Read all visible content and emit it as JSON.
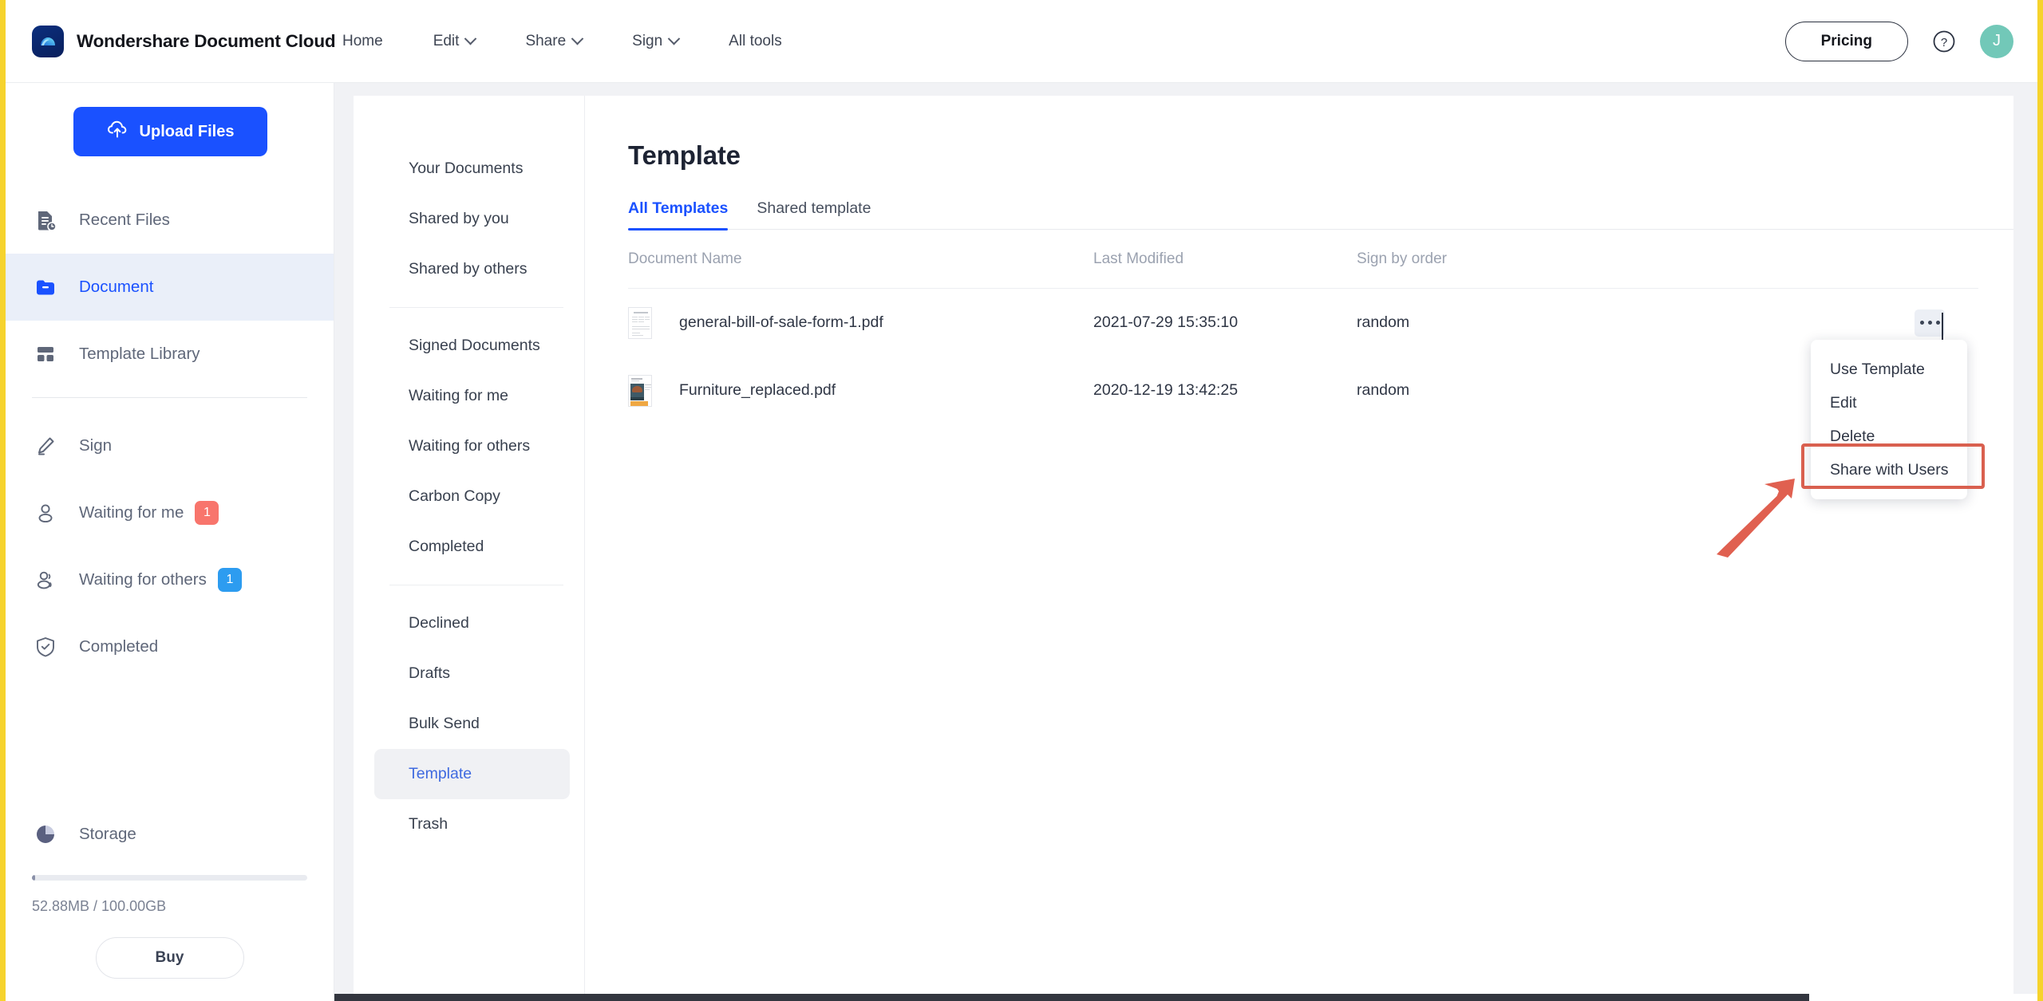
{
  "brand": {
    "name": "Wondershare Document Cloud",
    "logo_icon": "cloud-logo-icon"
  },
  "topnav": {
    "items": [
      {
        "label": "Home",
        "caret": false,
        "icon": ""
      },
      {
        "label": "Edit",
        "caret": true,
        "icon": "chevron-down-icon"
      },
      {
        "label": "Share",
        "caret": true,
        "icon": "chevron-down-icon"
      },
      {
        "label": "Sign",
        "caret": true,
        "icon": "chevron-down-icon"
      },
      {
        "label": "All tools",
        "caret": false,
        "icon": ""
      }
    ],
    "pricing_label": "Pricing",
    "help_icon": "question-circle-icon",
    "avatar_initial": "J",
    "avatar_color": "#72c8b8"
  },
  "sidebar": {
    "upload_label": "Upload Files",
    "upload_icon": "cloud-upload-icon",
    "upload_color": "#1a51ff",
    "group1": [
      {
        "label": "Recent Files",
        "icon": "recent-files-icon",
        "active": false,
        "badge": null
      },
      {
        "label": "Document",
        "icon": "folder-icon",
        "active": true,
        "badge": null
      },
      {
        "label": "Template Library",
        "icon": "template-library-icon",
        "active": false,
        "badge": null
      }
    ],
    "group2": [
      {
        "label": "Sign",
        "icon": "pen-icon",
        "active": false,
        "badge": null
      },
      {
        "label": "Waiting for me",
        "icon": "user-icon",
        "active": false,
        "badge": "1",
        "badge_color": "red"
      },
      {
        "label": "Waiting for others",
        "icon": "users-icon",
        "active": false,
        "badge": "1",
        "badge_color": "blue"
      },
      {
        "label": "Completed",
        "icon": "shield-check-icon",
        "active": false,
        "badge": null
      }
    ],
    "storage": {
      "label": "Storage",
      "icon": "pie-chart-icon",
      "usage_text": "52.88MB / 100.00GB",
      "percent": 0.05,
      "buy_label": "Buy"
    }
  },
  "doc_nav": {
    "group1": [
      {
        "label": "Your Documents",
        "active": false
      },
      {
        "label": "Shared by you",
        "active": false
      },
      {
        "label": "Shared by others",
        "active": false
      }
    ],
    "group2": [
      {
        "label": "Signed Documents",
        "active": false
      },
      {
        "label": "Waiting for me",
        "active": false
      },
      {
        "label": "Waiting for others",
        "active": false
      },
      {
        "label": "Carbon Copy",
        "active": false
      },
      {
        "label": "Completed",
        "active": false
      }
    ],
    "group3": [
      {
        "label": "Declined",
        "active": false
      },
      {
        "label": "Drafts",
        "active": false
      },
      {
        "label": "Bulk Send",
        "active": false
      },
      {
        "label": "Template",
        "active": true
      },
      {
        "label": "Trash",
        "active": false
      }
    ]
  },
  "main": {
    "title": "Template",
    "tabs": [
      {
        "label": "All Templates",
        "active": true
      },
      {
        "label": "Shared template",
        "active": false
      }
    ],
    "table": {
      "columns": [
        "Document Name",
        "Last Modified",
        "Sign by order"
      ],
      "rows": [
        {
          "name": "general-bill-of-sale-form-1.pdf",
          "modified": "2021-07-29 15:35:10",
          "sign_order": "random",
          "thumb": "document-page-thumbnail",
          "actions_icon": "more-options-icon"
        },
        {
          "name": "Furniture_replaced.pdf",
          "modified": "2020-12-19 13:42:25",
          "sign_order": "random",
          "thumb": "furniture-image-thumbnail",
          "actions_icon": "more-options-icon"
        }
      ]
    }
  },
  "context_menu": {
    "items": [
      {
        "label": "Use Template",
        "highlighted": false
      },
      {
        "label": "Edit",
        "highlighted": false
      },
      {
        "label": "Delete",
        "highlighted": false
      },
      {
        "label": "Share with Users",
        "highlighted": true
      }
    ]
  },
  "annotation": {
    "highlight_color": "#d9604f",
    "arrow_icon": "red-arrow-pointing-up-right"
  }
}
